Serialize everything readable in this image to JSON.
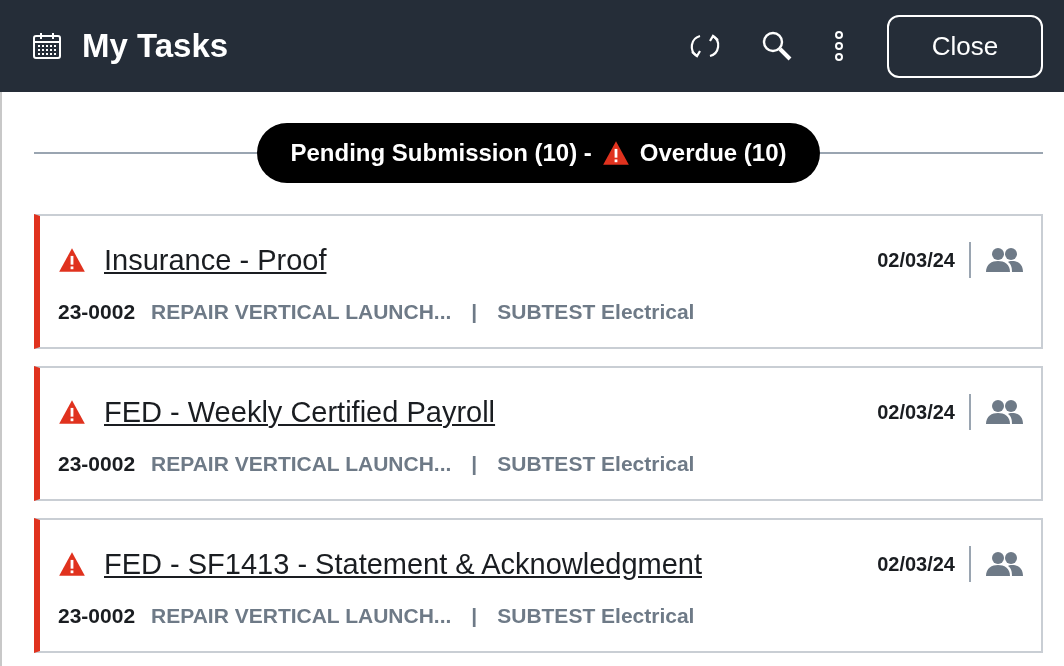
{
  "header": {
    "title": "My Tasks",
    "close_button": "Close"
  },
  "summary": {
    "pending": "Pending Submission (10) -",
    "overdue": "Overdue (10)"
  },
  "tasks": [
    {
      "title": "Insurance - Proof",
      "overdue": true,
      "date": "02/03/24",
      "number": "23-0002",
      "project": "REPAIR VERTICAL LAUNCH...",
      "separator": "|",
      "subtest": "SUBTEST Electrical"
    },
    {
      "title": "FED - Weekly Certified Payroll",
      "overdue": true,
      "date": "02/03/24",
      "number": "23-0002",
      "project": "REPAIR VERTICAL LAUNCH...",
      "separator": "|",
      "subtest": "SUBTEST Electrical"
    },
    {
      "title": "FED - SF1413 - Statement & Acknowledgment",
      "overdue": true,
      "date": "02/03/24",
      "number": "23-0002",
      "project": "REPAIR VERTICAL LAUNCH...",
      "separator": "|",
      "subtest": "SUBTEST Electrical"
    }
  ]
}
